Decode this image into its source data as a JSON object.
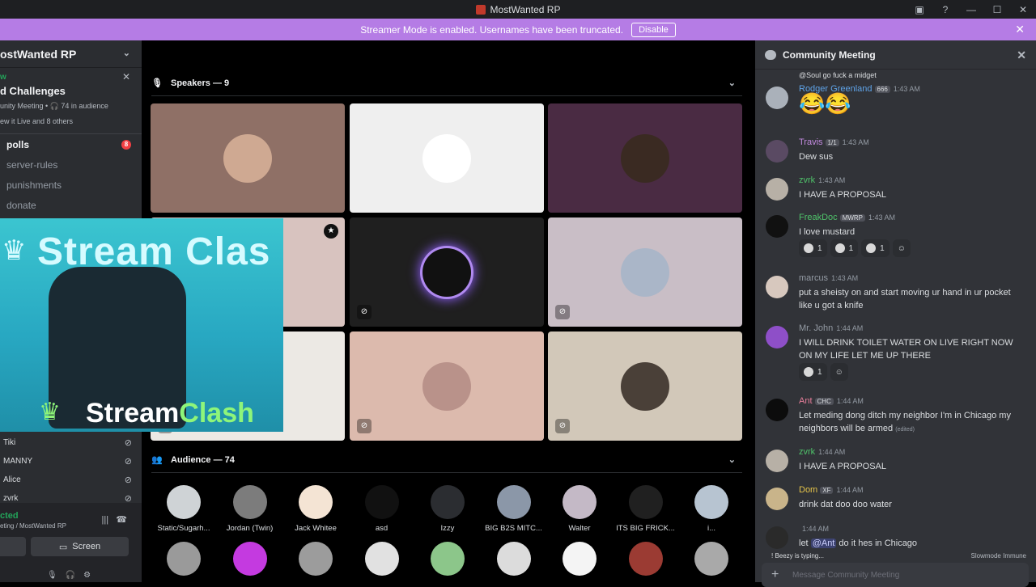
{
  "titlebar": {
    "title": "MostWanted RP"
  },
  "banner": {
    "text": "Streamer Mode is enabled. Usernames have been truncated.",
    "disable": "Disable"
  },
  "sidebar": {
    "server": "ostWanted RP",
    "stage_new": "w",
    "stage_title": "d Challenges",
    "stage_sub": "unity Meeting • 🎧 74 in audience",
    "stage_sub2": "ew it Live and 8 others",
    "channels": [
      {
        "label": "polls",
        "badge": "8"
      },
      {
        "label": "server-rules"
      },
      {
        "label": "punishments"
      },
      {
        "label": "donate"
      }
    ],
    "voice_users": [
      "Tiki",
      "MANNY",
      "Alice",
      "zvrk"
    ],
    "voice_status": "cted",
    "voice_channel": "eting / MostWanted RP",
    "screen_label": "Screen"
  },
  "stage": {
    "speakers_label": "Speakers — 9",
    "audience_label": "Audience — 74",
    "speaker_tiles": [
      {
        "bg": "#8f7066",
        "avatar": "#cfa992"
      },
      {
        "bg": "#efefef",
        "avatar": "#ffffff"
      },
      {
        "bg": "#4a2b43",
        "avatar": "#3a2a22"
      },
      {
        "bg": "#d8c3bf",
        "avatar": "#d8c3bf"
      },
      {
        "bg": "#1f1f1f",
        "avatar": "#111111"
      },
      {
        "bg": "#c9bec6",
        "avatar": "#aab6c8"
      },
      {
        "bg": "#ece9e4",
        "avatar": "#ece9e4"
      },
      {
        "bg": "#dcbaad",
        "avatar": "#b9928a"
      },
      {
        "bg": "#d2c8b9",
        "avatar": "#4a4038"
      }
    ],
    "audience_row1": [
      {
        "name": "Static/Sugarh...",
        "color": "#cfd3d6"
      },
      {
        "name": "Jordan (Twin)",
        "color": "#7c7c7c"
      },
      {
        "name": "Jack Whitee",
        "color": "#f4e4d4"
      },
      {
        "name": "asd",
        "color": "#111111"
      },
      {
        "name": "Izzy",
        "color": "#2b2d31"
      },
      {
        "name": "BIG B2S MITC...",
        "color": "#8b97a8"
      },
      {
        "name": "Walter",
        "color": "#c4b9c6"
      },
      {
        "name": "ITS BIG FRICK...",
        "color": "#202020"
      },
      {
        "name": "i...",
        "color": "#b7c4d1"
      }
    ],
    "audience_row2": [
      {
        "color": "#9a9a9a"
      },
      {
        "color": "#c43ae0"
      },
      {
        "color": "#9c9c9c"
      },
      {
        "color": "#e1e1e1"
      },
      {
        "color": "#8cc68a"
      },
      {
        "color": "#dcdcdc"
      },
      {
        "color": "#f4f4f4"
      },
      {
        "color": "#9b3b33"
      },
      {
        "color": "#a9a9a9"
      }
    ]
  },
  "overlay": {
    "top": "Stream Clas",
    "bottom_a": "Stream",
    "bottom_b": "Clash"
  },
  "chat": {
    "title": "Community Meeting",
    "reply_user": "@Soul",
    "reply_text": "go fuck a midget",
    "messages": [
      {
        "name": "Rodger Greenland",
        "color": "#5fa3e7",
        "tag": "666",
        "time": "1:43 AM",
        "text": "😂😂",
        "avatar": "#aab1ba"
      },
      {
        "name": "Travis",
        "color": "#c38be0",
        "tag": "1/1",
        "time": "1:43 AM",
        "text": "Dew sus",
        "avatar": "#5a4a63"
      },
      {
        "name": "zvrk",
        "color": "#4fc26a",
        "tag": "",
        "time": "1:43 AM",
        "text": "I HAVE A PROPOSAL",
        "avatar": "#b7b0a6"
      },
      {
        "name": "FreakDoc",
        "color": "#4fc26a",
        "tag": "MWRP",
        "time": "1:43 AM",
        "text": "I love mustard",
        "avatar": "#111111"
      },
      {
        "name": "marcus",
        "color": "#949ba4",
        "tag": "",
        "time": "1:43 AM",
        "text": "put a sheisty on and start moving ur hand in ur pocket like u got a knife",
        "avatar": "#d7c8be"
      },
      {
        "name": "Mr. John",
        "color": "#949ba4",
        "tag": "",
        "time": "1:44 AM",
        "text": "I WILL DRINK TOILET WATER ON LIVE RIGHT NOW ON MY LIFE LET ME UP THERE",
        "avatar": "#8e4fc8"
      },
      {
        "name": "Ant",
        "color": "#e67e9a",
        "tag": "CHC",
        "time": "1:44 AM",
        "text": "Let meding  dong ditch my neighbor I'm in Chicago my neighbors will be armed",
        "avatar": "#0c0c0c"
      },
      {
        "name": "zvrk",
        "color": "#4fc26a",
        "tag": "",
        "time": "1:44 AM",
        "text": "I HAVE A PROPOSAL",
        "avatar": "#b7b0a6"
      },
      {
        "name": "Dom",
        "color": "#e6c54a",
        "tag": "XF",
        "time": "1:44 AM",
        "text": "drink dat doo doo water",
        "avatar": "#c9b48a"
      },
      {
        "name": "",
        "color": "#e67e9a",
        "tag": "",
        "time": "1:44 AM",
        "text_pre": "let ",
        "mention": "@Ant",
        "text_post": " do it hes in Chicago",
        "avatar": "#2a2a2a"
      }
    ],
    "reactions_freak": [
      "1",
      "1",
      "1"
    ],
    "reactions_john": [
      "1"
    ],
    "edited": "(edited)",
    "typing": "! Beezy is typing...",
    "slowmode": "Slowmode Immune",
    "composer_placeholder": "Message Community Meeting"
  }
}
